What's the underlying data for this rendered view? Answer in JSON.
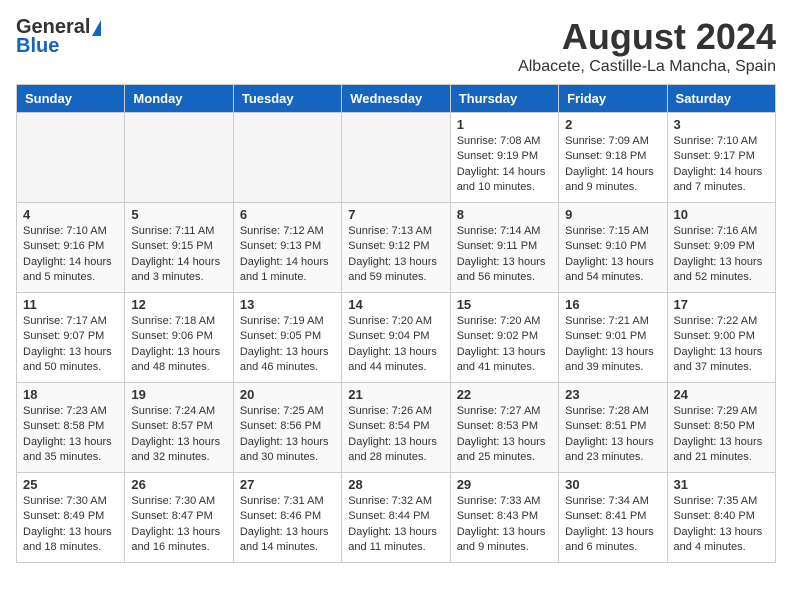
{
  "logo": {
    "general": "General",
    "blue": "Blue"
  },
  "title": {
    "month_year": "August 2024",
    "location": "Albacete, Castille-La Mancha, Spain"
  },
  "days_of_week": [
    "Sunday",
    "Monday",
    "Tuesday",
    "Wednesday",
    "Thursday",
    "Friday",
    "Saturday"
  ],
  "weeks": [
    [
      {
        "day": "",
        "empty": true
      },
      {
        "day": "",
        "empty": true
      },
      {
        "day": "",
        "empty": true
      },
      {
        "day": "",
        "empty": true
      },
      {
        "day": "1",
        "sunrise": "7:08 AM",
        "sunset": "9:19 PM",
        "daylight": "14 hours and 10 minutes."
      },
      {
        "day": "2",
        "sunrise": "7:09 AM",
        "sunset": "9:18 PM",
        "daylight": "14 hours and 9 minutes."
      },
      {
        "day": "3",
        "sunrise": "7:10 AM",
        "sunset": "9:17 PM",
        "daylight": "14 hours and 7 minutes."
      }
    ],
    [
      {
        "day": "4",
        "sunrise": "7:10 AM",
        "sunset": "9:16 PM",
        "daylight": "14 hours and 5 minutes."
      },
      {
        "day": "5",
        "sunrise": "7:11 AM",
        "sunset": "9:15 PM",
        "daylight": "14 hours and 3 minutes."
      },
      {
        "day": "6",
        "sunrise": "7:12 AM",
        "sunset": "9:13 PM",
        "daylight": "14 hours and 1 minute."
      },
      {
        "day": "7",
        "sunrise": "7:13 AM",
        "sunset": "9:12 PM",
        "daylight": "13 hours and 59 minutes."
      },
      {
        "day": "8",
        "sunrise": "7:14 AM",
        "sunset": "9:11 PM",
        "daylight": "13 hours and 56 minutes."
      },
      {
        "day": "9",
        "sunrise": "7:15 AM",
        "sunset": "9:10 PM",
        "daylight": "13 hours and 54 minutes."
      },
      {
        "day": "10",
        "sunrise": "7:16 AM",
        "sunset": "9:09 PM",
        "daylight": "13 hours and 52 minutes."
      }
    ],
    [
      {
        "day": "11",
        "sunrise": "7:17 AM",
        "sunset": "9:07 PM",
        "daylight": "13 hours and 50 minutes."
      },
      {
        "day": "12",
        "sunrise": "7:18 AM",
        "sunset": "9:06 PM",
        "daylight": "13 hours and 48 minutes."
      },
      {
        "day": "13",
        "sunrise": "7:19 AM",
        "sunset": "9:05 PM",
        "daylight": "13 hours and 46 minutes."
      },
      {
        "day": "14",
        "sunrise": "7:20 AM",
        "sunset": "9:04 PM",
        "daylight": "13 hours and 44 minutes."
      },
      {
        "day": "15",
        "sunrise": "7:20 AM",
        "sunset": "9:02 PM",
        "daylight": "13 hours and 41 minutes."
      },
      {
        "day": "16",
        "sunrise": "7:21 AM",
        "sunset": "9:01 PM",
        "daylight": "13 hours and 39 minutes."
      },
      {
        "day": "17",
        "sunrise": "7:22 AM",
        "sunset": "9:00 PM",
        "daylight": "13 hours and 37 minutes."
      }
    ],
    [
      {
        "day": "18",
        "sunrise": "7:23 AM",
        "sunset": "8:58 PM",
        "daylight": "13 hours and 35 minutes."
      },
      {
        "day": "19",
        "sunrise": "7:24 AM",
        "sunset": "8:57 PM",
        "daylight": "13 hours and 32 minutes."
      },
      {
        "day": "20",
        "sunrise": "7:25 AM",
        "sunset": "8:56 PM",
        "daylight": "13 hours and 30 minutes."
      },
      {
        "day": "21",
        "sunrise": "7:26 AM",
        "sunset": "8:54 PM",
        "daylight": "13 hours and 28 minutes."
      },
      {
        "day": "22",
        "sunrise": "7:27 AM",
        "sunset": "8:53 PM",
        "daylight": "13 hours and 25 minutes."
      },
      {
        "day": "23",
        "sunrise": "7:28 AM",
        "sunset": "8:51 PM",
        "daylight": "13 hours and 23 minutes."
      },
      {
        "day": "24",
        "sunrise": "7:29 AM",
        "sunset": "8:50 PM",
        "daylight": "13 hours and 21 minutes."
      }
    ],
    [
      {
        "day": "25",
        "sunrise": "7:30 AM",
        "sunset": "8:49 PM",
        "daylight": "13 hours and 18 minutes."
      },
      {
        "day": "26",
        "sunrise": "7:30 AM",
        "sunset": "8:47 PM",
        "daylight": "13 hours and 16 minutes."
      },
      {
        "day": "27",
        "sunrise": "7:31 AM",
        "sunset": "8:46 PM",
        "daylight": "13 hours and 14 minutes."
      },
      {
        "day": "28",
        "sunrise": "7:32 AM",
        "sunset": "8:44 PM",
        "daylight": "13 hours and 11 minutes."
      },
      {
        "day": "29",
        "sunrise": "7:33 AM",
        "sunset": "8:43 PM",
        "daylight": "13 hours and 9 minutes."
      },
      {
        "day": "30",
        "sunrise": "7:34 AM",
        "sunset": "8:41 PM",
        "daylight": "13 hours and 6 minutes."
      },
      {
        "day": "31",
        "sunrise": "7:35 AM",
        "sunset": "8:40 PM",
        "daylight": "13 hours and 4 minutes."
      }
    ]
  ],
  "labels": {
    "sunrise": "Sunrise:",
    "sunset": "Sunset:",
    "daylight": "Daylight:"
  }
}
